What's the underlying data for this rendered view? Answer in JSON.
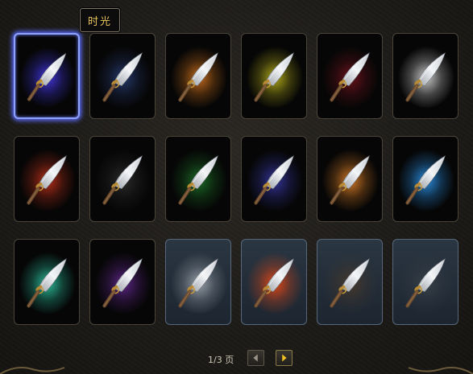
{
  "tooltip": {
    "label": "时光"
  },
  "pager": {
    "page_text": "1/3 页"
  },
  "colors": {
    "accent": "#e8c45a",
    "selection": "#8fa2ff"
  },
  "cards": [
    {
      "name": "blade-card-1",
      "aura": "#4a3cff",
      "selected": true,
      "blue_bg": false
    },
    {
      "name": "blade-card-2",
      "aura": "#2a3f7a",
      "selected": false,
      "blue_bg": false
    },
    {
      "name": "blade-card-3",
      "aura": "#e07a1e",
      "selected": false,
      "blue_bg": false
    },
    {
      "name": "blade-card-4",
      "aura": "#c9c21c",
      "selected": false,
      "blue_bg": false
    },
    {
      "name": "blade-card-5",
      "aura": "#7a1520",
      "selected": false,
      "blue_bg": false
    },
    {
      "name": "blade-card-6",
      "aura": "#e8e8e8",
      "selected": false,
      "blue_bg": false
    },
    {
      "name": "blade-card-7",
      "aura": "#d0341c",
      "selected": false,
      "blue_bg": false
    },
    {
      "name": "blade-card-8",
      "aura": "#303030",
      "selected": false,
      "blue_bg": false
    },
    {
      "name": "blade-card-9",
      "aura": "#1f7a2a",
      "selected": false,
      "blue_bg": false
    },
    {
      "name": "blade-card-10",
      "aura": "#3a3ab0",
      "selected": false,
      "blue_bg": false
    },
    {
      "name": "blade-card-11",
      "aura": "#f08a2a",
      "selected": false,
      "blue_bg": false
    },
    {
      "name": "blade-card-12",
      "aura": "#2ea0ff",
      "selected": false,
      "blue_bg": false
    },
    {
      "name": "blade-card-13",
      "aura": "#2fd6b0",
      "selected": false,
      "blue_bg": false
    },
    {
      "name": "blade-card-14",
      "aura": "#6a2a9a",
      "selected": false,
      "blue_bg": false
    },
    {
      "name": "blade-card-15",
      "aura": "#aab0b8",
      "selected": false,
      "blue_bg": true
    },
    {
      "name": "blade-card-16",
      "aura": "#ff4a10",
      "selected": false,
      "blue_bg": true
    },
    {
      "name": "blade-card-17",
      "aura": "#4a3a2a",
      "selected": false,
      "blue_bg": true
    },
    {
      "name": "blade-card-18",
      "aura": "#3a4048",
      "selected": false,
      "blue_bg": true
    }
  ]
}
